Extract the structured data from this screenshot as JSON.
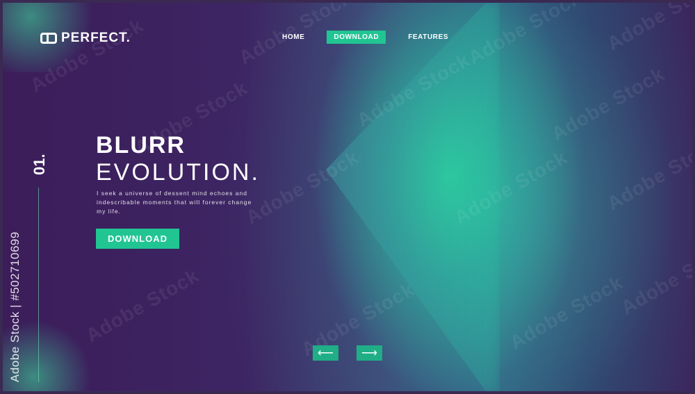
{
  "brand": {
    "name": "PERFECT."
  },
  "nav": {
    "items": [
      "HOME",
      "DOWNLOAD",
      "FEATURES"
    ],
    "active": "DOWNLOAD"
  },
  "hero": {
    "slide_number": "01.",
    "title_line1": "BLURR",
    "title_line2": "EVOLUTION.",
    "description": "I seek a universe of dessent mind echoes and indescribable moments that will forever change my life.",
    "cta_label": "DOWNLOAD"
  },
  "pager": {
    "prev_symbol": "⟵",
    "next_symbol": "⟶"
  },
  "watermark": {
    "text": "Adobe Stock",
    "id_text": "Adobe Stock | #502710699"
  },
  "colors": {
    "accent": "#21c592",
    "background": "#3c1d5a",
    "glow": "#2ee0a0"
  }
}
